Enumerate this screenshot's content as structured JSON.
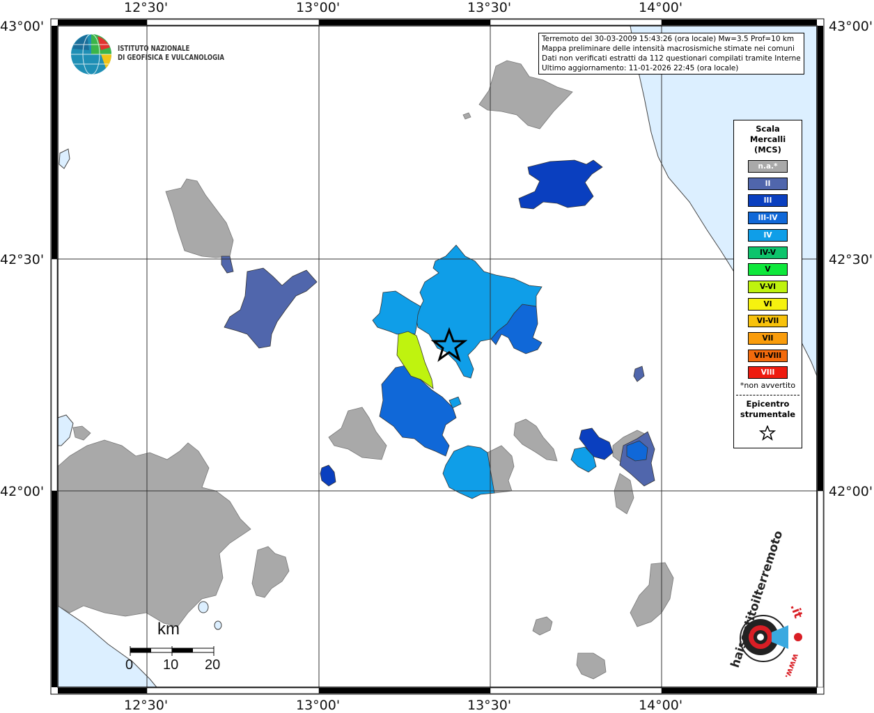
{
  "header": {
    "info_lines": [
      "Terremoto del 30-03-2009 15:43:26 (ora locale) Mw=3.5 Prof=10 km",
      "Mappa preliminare delle intensità macrosismiche stimate nei comuni",
      "Dati non verificati estratti da 112 questionari compilati tramite Internet.",
      "Ultimo aggiornamento: 11-01-2026 22:45 (ora locale)"
    ]
  },
  "institute": {
    "line1": "ISTITUTO NAZIONALE",
    "line2": "DI GEOFISICA E VULCANOLOGIA"
  },
  "axes": {
    "longitude_labels": [
      "12°30'",
      "13°00'",
      "13°30'",
      "14°00'"
    ],
    "latitude_labels": [
      "43°00'",
      "42°30'",
      "42°00'"
    ]
  },
  "legend": {
    "title_lines": [
      "Scala",
      "Mercalli",
      "(MCS)"
    ],
    "items": [
      {
        "label": "n.a.*",
        "color": "#a9a9a9",
        "text_color": "#ffffff"
      },
      {
        "label": "II",
        "color": "#5066ac",
        "text_color": "#ffffff"
      },
      {
        "label": "III",
        "color": "#0a3fbf",
        "text_color": "#ffffff"
      },
      {
        "label": "III-IV",
        "color": "#1068d8",
        "text_color": "#ffffff"
      },
      {
        "label": "IV",
        "color": "#0f9ee8",
        "text_color": "#ffffff"
      },
      {
        "label": "IV-V",
        "color": "#0dc46c",
        "text_color": "#000000"
      },
      {
        "label": "V",
        "color": "#0ee83b",
        "text_color": "#000000"
      },
      {
        "label": "V-VI",
        "color": "#bff30f",
        "text_color": "#000000"
      },
      {
        "label": "VI",
        "color": "#f6f20f",
        "text_color": "#000000"
      },
      {
        "label": "VI-VII",
        "color": "#f8c20c",
        "text_color": "#000000"
      },
      {
        "label": "VII",
        "color": "#f99c0c",
        "text_color": "#000000"
      },
      {
        "label": "VII-VIII",
        "color": "#f36a0c",
        "text_color": "#000000"
      },
      {
        "label": "VIII",
        "color": "#ee1b0f",
        "text_color": "#ffffff"
      }
    ],
    "note": "*non avvertito",
    "epicenter_lines": [
      "Epicentro",
      "strumentale"
    ]
  },
  "scale_bar": {
    "unit": "km",
    "labels": [
      "0",
      "10",
      "20"
    ]
  },
  "brand": {
    "text1": "haisentitoilterremoto",
    "text2": ".it",
    "text3": "www."
  },
  "colors": {
    "sea": "#dcefff",
    "na": "#a9a9a9",
    "II": "#5066ac",
    "III": "#0a3fbf",
    "III_IV": "#1068d8",
    "IV": "#0f9ee8",
    "V_VI": "#bff30f"
  }
}
